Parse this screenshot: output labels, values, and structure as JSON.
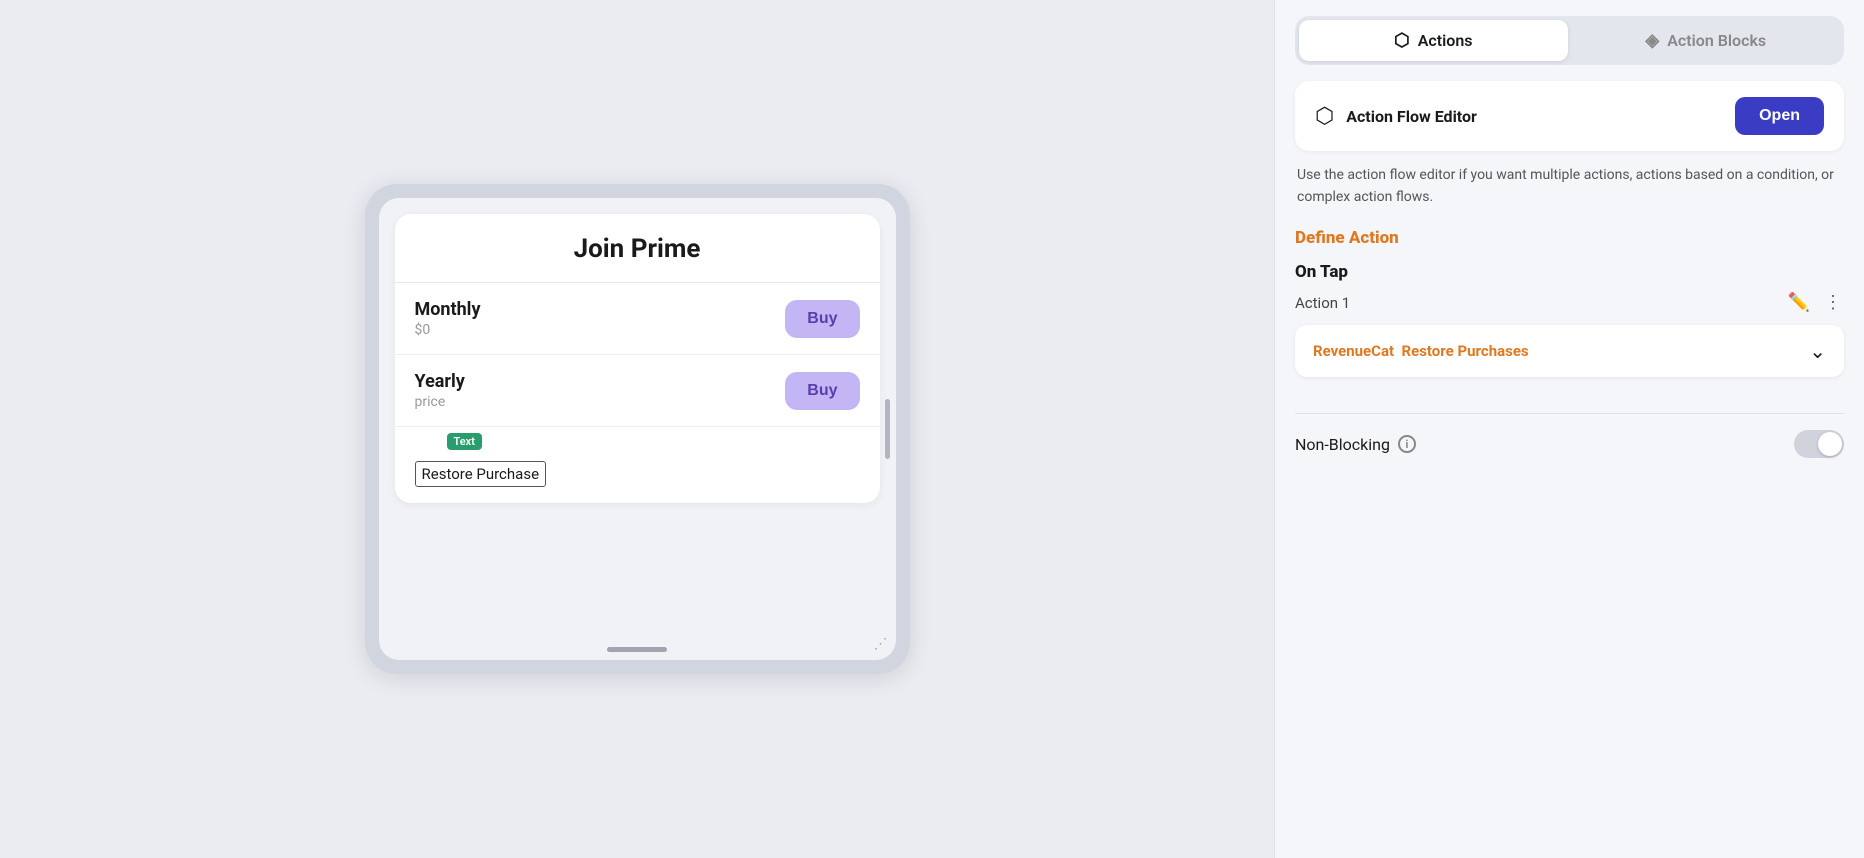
{
  "tabs": {
    "actions_label": "Actions",
    "action_blocks_label": "Action Blocks"
  },
  "editor": {
    "label": "Action Flow Editor",
    "open_button": "Open",
    "description": "Use the action flow editor if you want multiple actions, actions based on a condition, or complex action flows."
  },
  "define_action": {
    "label": "Define Action",
    "on_tap": "On Tap",
    "action_name": "Action 1",
    "revenue_cat_text": "RevenueCat",
    "revenue_cat_action": "Restore Purchases",
    "non_blocking_label": "Non-Blocking"
  },
  "card": {
    "title": "Join Prime",
    "monthly_label": "Monthly",
    "monthly_price": "$0",
    "yearly_label": "Yearly",
    "yearly_price": "price",
    "buy_button": "Buy",
    "restore_text": "Restore Purchase",
    "text_tooltip": "Text"
  }
}
